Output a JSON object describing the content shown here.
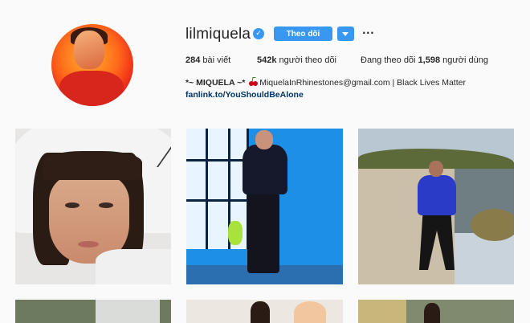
{
  "profile": {
    "username": "lilmiquela",
    "verified_glyph": "✓",
    "follow_label": "Theo dõi",
    "more_glyph": "···",
    "stats": [
      {
        "count": "284",
        "label": "bài viết"
      },
      {
        "count": "542k",
        "label": "người theo dõi"
      },
      {
        "prefix": "Đang theo dõi",
        "count": "1,598",
        "label": "người dùng"
      }
    ],
    "bio": {
      "name": "*~ MIQUELA ~*",
      "rest": "MiquelaInRhinestones@gmail.com | Black Lives Matter",
      "link": "fanlink.to/YouShouldBeAlone"
    }
  },
  "icons": {
    "verified": "verified-badge-icon",
    "dropdown": "chevron-down-icon",
    "more": "more-options-icon",
    "bio_emoji": "cherry-icon"
  },
  "colors": {
    "accent": "#3897f0",
    "link": "#003569",
    "text": "#262626",
    "background": "#fafafa"
  },
  "posts": [
    {
      "subject": "close-up portrait white hood"
    },
    {
      "subject": "standing against blue wall"
    },
    {
      "subject": "standing by river in blue jacket"
    },
    {
      "subject": "outdoor building"
    },
    {
      "subject": "indoor scene"
    },
    {
      "subject": "outdoor garden"
    }
  ]
}
